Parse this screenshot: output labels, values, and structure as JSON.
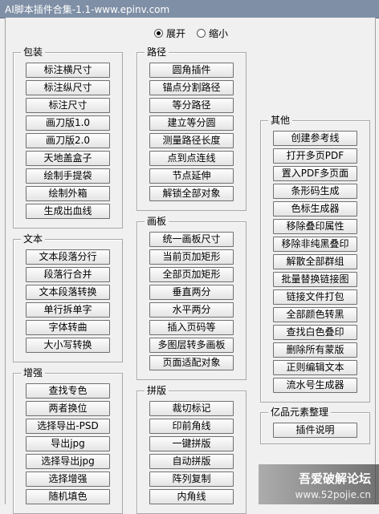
{
  "window": {
    "title": "AI脚本插件合集-1.1-www.epinv.com"
  },
  "view_mode": {
    "options": [
      "展开",
      "缩小"
    ],
    "selected": "展开"
  },
  "groups": {
    "baozhuang": {
      "title": "包装",
      "buttons": [
        "标注横尺寸",
        "标注纵尺寸",
        "标注尺寸",
        "画刀版1.0",
        "画刀版2.0",
        "天地盖盒子",
        "绘制手提袋",
        "绘制外箱",
        "生成出血线"
      ]
    },
    "lujing": {
      "title": "路径",
      "buttons": [
        "圆角插件",
        "锚点分割路径",
        "等分路径",
        "建立等分圆",
        "测量路径长度",
        "点到点连线",
        "节点延伸",
        "解锁全部对象"
      ]
    },
    "wenben": {
      "title": "文本",
      "buttons": [
        "文本段落分行",
        "段落行合并",
        "文本段落转换",
        "单行拆单字",
        "字体转曲",
        "大小写转换"
      ]
    },
    "huaban": {
      "title": "画板",
      "buttons": [
        "统一画板尺寸",
        "当前页加矩形",
        "全部页加矩形",
        "垂直两分",
        "水平两分",
        "插入页码等",
        "多图层转多画板",
        "页面适配对象"
      ]
    },
    "zengqiang": {
      "title": "增强",
      "buttons": [
        "查找专色",
        "两者换位",
        "选择导出-PSD",
        "导出jpg",
        "选择导出jpg",
        "选择增强",
        "随机填色"
      ]
    },
    "pinban": {
      "title": "拼版",
      "buttons": [
        "裁切标记",
        "印前角线",
        "一键拼版",
        "自动拼版",
        "阵列复制",
        "内角线"
      ]
    },
    "qita": {
      "title": "其他",
      "buttons": [
        "创建参考线",
        "打开多页PDF",
        "置入PDF多页面",
        "条形码生成",
        "色标生成器",
        "移除叠印属性",
        "移除非纯黑叠印",
        "解散全部群组",
        "批量替换链接图",
        "链接文件打包",
        "全部颜色转黑",
        "查找白色叠印",
        "删除所有蒙版",
        "正则编辑文本",
        "流水号生成器"
      ]
    },
    "yipin": {
      "title": "亿品元素整理",
      "buttons": [
        "插件说明"
      ]
    }
  },
  "watermark": {
    "line1": "吾爱破解论坛",
    "line2": "www.52pojie.cn"
  }
}
